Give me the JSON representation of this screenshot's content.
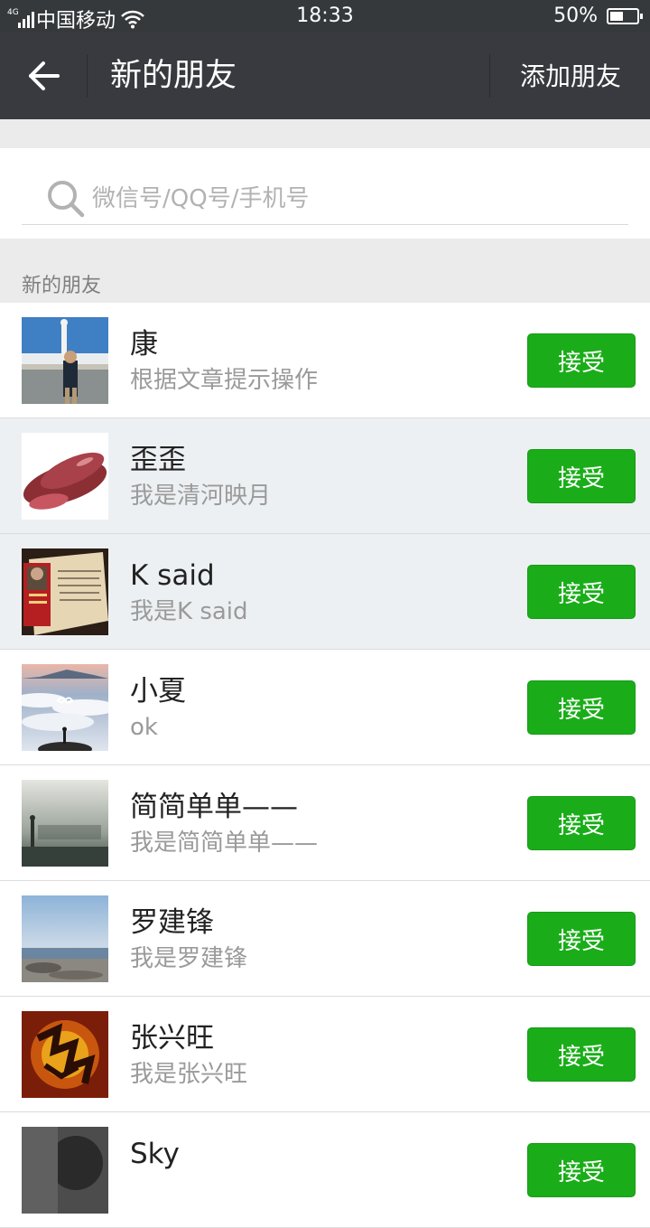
{
  "status_bar": {
    "network": "4G",
    "carrier": "中国移动",
    "time": "18:33",
    "battery": "50%",
    "battery_level": 0.5
  },
  "header": {
    "back_icon": "arrow-left-icon",
    "title": "新的朋友",
    "add_friend_label": "添加朋友"
  },
  "search": {
    "icon": "search-icon",
    "placeholder": "微信号/QQ号/手机号",
    "value": ""
  },
  "section_label": "新的朋友",
  "requests": [
    {
      "name": "康",
      "message": "根据文章提示操作",
      "action": "接受",
      "avatar": "person-at-seaside-statue"
    },
    {
      "name": "歪歪",
      "message": "我是清河映月",
      "action": "接受",
      "avatar": "sweet-potatoes"
    },
    {
      "name": "K said",
      "message": "我是K said",
      "action": "接受",
      "avatar": "book-with-portrait"
    },
    {
      "name": "小夏",
      "message": "ok",
      "action": "接受",
      "avatar": "sea-of-clouds"
    },
    {
      "name": "简简单单——",
      "message": "我是简简单单——",
      "action": "接受",
      "avatar": "alone-text-landscape"
    },
    {
      "name": "罗建锋",
      "message": "我是罗建锋",
      "action": "接受",
      "avatar": "beach-sky"
    },
    {
      "name": "张兴旺",
      "message": "我是张兴旺",
      "action": "接受",
      "avatar": "golden-calligraphy"
    },
    {
      "name": "Sky",
      "message": "",
      "action": "接受",
      "avatar": "dark-portrait"
    }
  ],
  "colors": {
    "header_bg": "#393a3f",
    "status_bg": "#36393c",
    "accept_green": "#1aad19",
    "highlight_row": "#edf0f3"
  }
}
